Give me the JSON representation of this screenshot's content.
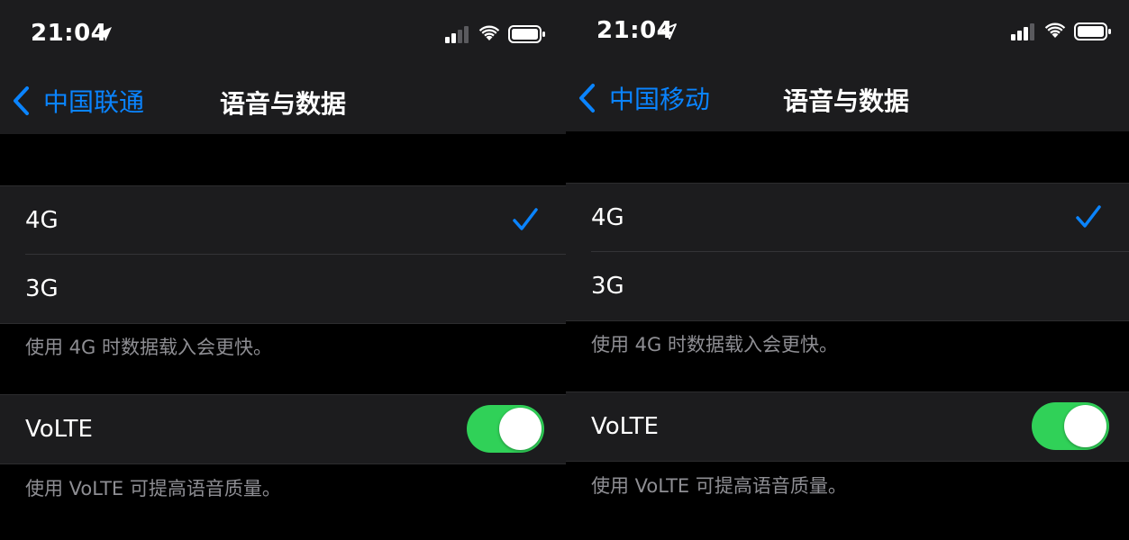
{
  "colors": {
    "accent": "#0a84ff",
    "toggle_on": "#30d158",
    "background": "#000000",
    "surface": "#1c1c1e",
    "secondary_text": "#8e8e93"
  },
  "screens": [
    {
      "status": {
        "time": "21:04",
        "icons": [
          "location-arrow-icon",
          "cellular-signal-icon",
          "wifi-icon",
          "battery-icon"
        ]
      },
      "nav": {
        "back_label": "中国联通",
        "title": "语音与数据"
      },
      "network_options": [
        {
          "label": "4G",
          "selected": true
        },
        {
          "label": "3G",
          "selected": false
        }
      ],
      "network_note": "使用 4G 时数据载入会更快。",
      "volte": {
        "label": "VoLTE",
        "enabled": true
      },
      "volte_note": "使用 VoLTE 可提高语音质量。"
    },
    {
      "status": {
        "time": "21:04",
        "icons": [
          "location-arrow-icon",
          "cellular-signal-icon",
          "wifi-icon",
          "battery-icon"
        ]
      },
      "nav": {
        "back_label": "中国移动",
        "title": "语音与数据"
      },
      "network_options": [
        {
          "label": "4G",
          "selected": true
        },
        {
          "label": "3G",
          "selected": false
        }
      ],
      "network_note": "使用 4G 时数据载入会更快。",
      "volte": {
        "label": "VoLTE",
        "enabled": true
      },
      "volte_note": "使用 VoLTE 可提高语音质量。"
    }
  ]
}
